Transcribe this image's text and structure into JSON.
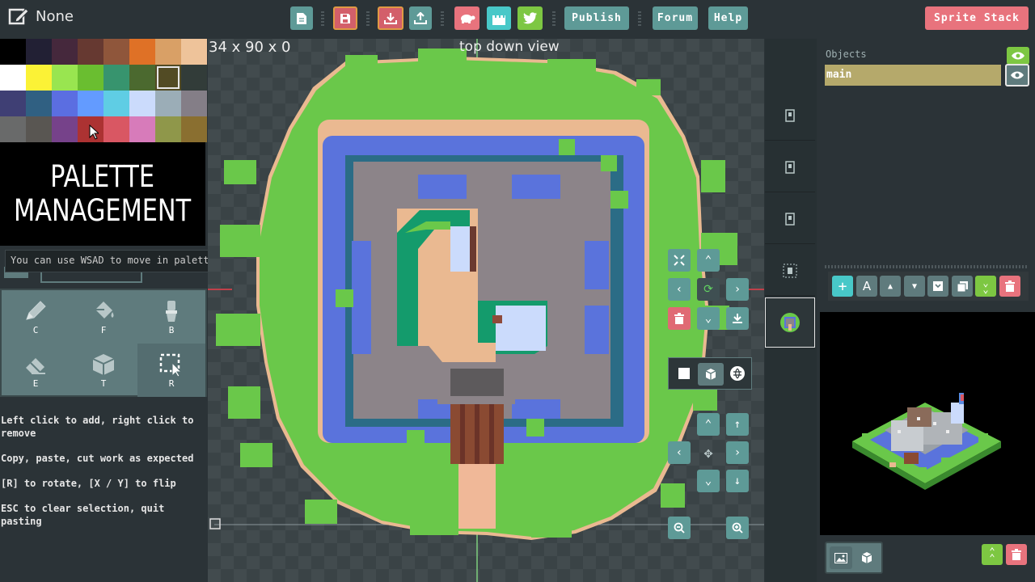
{
  "app": {
    "file_name": "None",
    "brand_button": "Sprite Stack"
  },
  "toolbar": {
    "publish": "Publish",
    "forum": "Forum",
    "help": "Help"
  },
  "canvas": {
    "dimensions": "34 x 90 x 0",
    "view_label": "top down view"
  },
  "palette": {
    "colors": [
      "#000000",
      "#222034",
      "#45283c",
      "#663931",
      "#8f563b",
      "#df7126",
      "#d9a066",
      "#eec39a",
      "#ffffff",
      "#fbf236",
      "#99e550",
      "#6abe30",
      "#37946e",
      "#4b692f",
      "#524b24",
      "#323c39",
      "#3f3f74",
      "#306082",
      "#5b6ee1",
      "#639bff",
      "#5fcde4",
      "#cbdbfc",
      "#9badb7",
      "#847e87",
      "#696a6a",
      "#595652",
      "#76428a",
      "#ac3232",
      "#d95763",
      "#d77bba",
      "#8f974a",
      "#8a6f30"
    ],
    "selected_index": 14,
    "promo_line1": "PALETTE",
    "promo_line2": "MANAGEMENT",
    "tip": "You can use WSAD to move in palette"
  },
  "tools": [
    {
      "key": "C",
      "icon": "pencil-icon"
    },
    {
      "key": "F",
      "icon": "bucket-icon"
    },
    {
      "key": "B",
      "icon": "brush-icon"
    },
    {
      "key": "E",
      "icon": "eraser-icon"
    },
    {
      "key": "T",
      "icon": "cube-icon"
    },
    {
      "key": "R",
      "icon": "select-icon"
    }
  ],
  "instructions": [
    "Left click to add, right click to remove",
    "Copy, paste, cut work as expected",
    "[R] to rotate, [X / Y] to flip",
    "ESC to clear selection, quit pasting"
  ],
  "objects": {
    "header": "Objects",
    "items": [
      "main"
    ]
  },
  "colors": {
    "accent": "#5e9a97",
    "danger": "#e8737d",
    "grass": "#6abe30",
    "water": "#5b6ee1",
    "stone": "#847e87",
    "sand": "#eec39a"
  }
}
